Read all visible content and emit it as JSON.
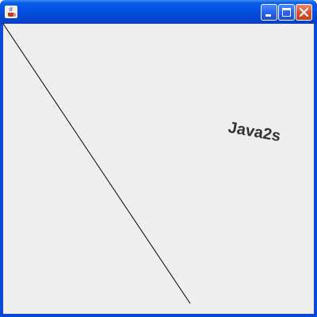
{
  "window": {
    "title": "",
    "controls": [
      "minimize-icon",
      "maximize-icon",
      "close-icon"
    ]
  },
  "canvas": {
    "background": "#eeeeee",
    "text": "Java2s",
    "text_rotation_deg": 10,
    "text_color": "#333333",
    "line_color": "#000000"
  }
}
